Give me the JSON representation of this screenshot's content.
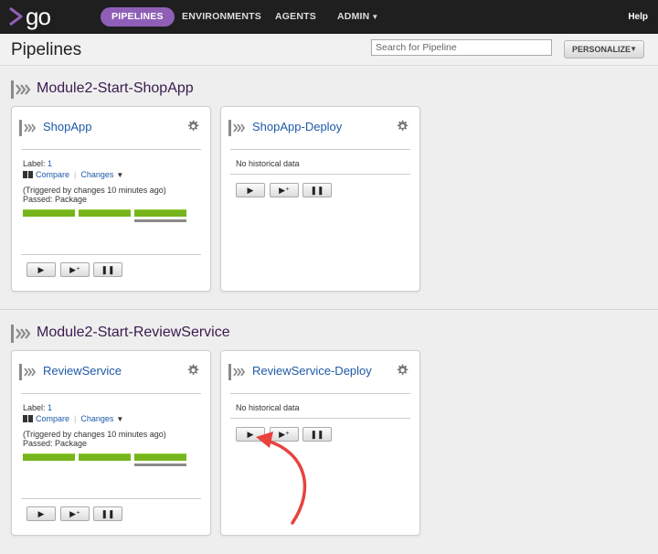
{
  "nav": {
    "logo_text": "go",
    "items": [
      "PIPELINES",
      "ENVIRONMENTS",
      "AGENTS",
      "ADMIN"
    ],
    "admin_caret": "▼",
    "help": "Help"
  },
  "header": {
    "title": "Pipelines",
    "search_placeholder": "Search for Pipeline",
    "personalize": "PERSONALIZE",
    "personalize_caret": "▼"
  },
  "groups": [
    {
      "name": "Module2-Start-ShopApp",
      "pipelines": [
        {
          "name": "ShopApp",
          "label_prefix": "Label: ",
          "label_value": "1",
          "compare": "Compare",
          "changes": "Changes",
          "triggered": "(Triggered by changes 10 minutes ago)",
          "passed": "Passed: Package",
          "stages": [
            "passed",
            "passed",
            "passed"
          ]
        },
        {
          "name": "ShopApp-Deploy",
          "no_history": "No historical data"
        }
      ]
    },
    {
      "name": "Module2-Start-ReviewService",
      "pipelines": [
        {
          "name": "ReviewService",
          "label_prefix": "Label: ",
          "label_value": "1",
          "compare": "Compare",
          "changes": "Changes",
          "triggered": "(Triggered by changes 10 minutes ago)",
          "passed": "Passed: Package",
          "stages": [
            "passed",
            "passed",
            "passed"
          ]
        },
        {
          "name": "ReviewService-Deploy",
          "no_history": "No historical data"
        }
      ]
    }
  ],
  "buttons": {
    "trigger": "▶",
    "trigger_with_options": "▶⁺",
    "pause": "❚❚"
  },
  "colors": {
    "nav_active": "#8f5fb8",
    "stage_passed": "#76b51c",
    "link": "#1e5aa8",
    "arrow": "#e8433f"
  }
}
